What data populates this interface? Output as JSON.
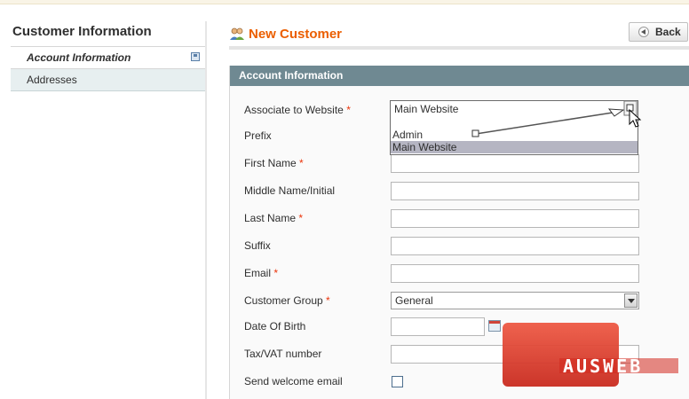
{
  "sidebar": {
    "title": "Customer Information",
    "tabs": [
      {
        "label": "Account Information"
      },
      {
        "label": "Addresses"
      }
    ]
  },
  "header": {
    "title": "New Customer",
    "back_label": "Back"
  },
  "section": {
    "title": "Account Information"
  },
  "form": {
    "website": {
      "label": "Associate to Website",
      "value": "Main Website",
      "options": [
        "Admin",
        "Main Website"
      ],
      "selected": "Main Website"
    },
    "prefix": {
      "label": "Prefix",
      "value": ""
    },
    "firstname": {
      "label": "First Name",
      "value": ""
    },
    "middlename": {
      "label": "Middle Name/Initial",
      "value": ""
    },
    "lastname": {
      "label": "Last Name",
      "value": ""
    },
    "suffix": {
      "label": "Suffix",
      "value": ""
    },
    "email": {
      "label": "Email",
      "value": ""
    },
    "group": {
      "label": "Customer Group",
      "value": "General"
    },
    "dob": {
      "label": "Date Of Birth",
      "value": ""
    },
    "taxvat": {
      "label": "Tax/VAT number",
      "value": ""
    },
    "welcome": {
      "label": "Send welcome email",
      "checked": false
    },
    "required_mark": "*"
  },
  "watermark": {
    "text": "AUSWEB"
  },
  "colors": {
    "accent": "#eb5e00",
    "section_header": "#6f8992",
    "required": "#eb340a",
    "watermark": "#d9362a"
  }
}
